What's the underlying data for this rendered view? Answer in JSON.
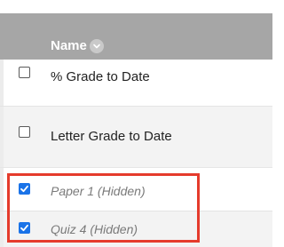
{
  "header": {
    "name_label": "Name"
  },
  "rows": [
    {
      "label": "% Grade to Date",
      "checked": false,
      "hidden": false
    },
    {
      "label": "Letter Grade to Date",
      "checked": false,
      "hidden": false
    },
    {
      "label": "Paper 1 (Hidden)",
      "checked": true,
      "hidden": true
    },
    {
      "label": "Quiz 4 (Hidden)",
      "checked": true,
      "hidden": true
    }
  ],
  "colors": {
    "header_bg": "#a6a6a6",
    "checkbox_checked": "#1a73e8",
    "highlight_border": "#e53b2c"
  }
}
